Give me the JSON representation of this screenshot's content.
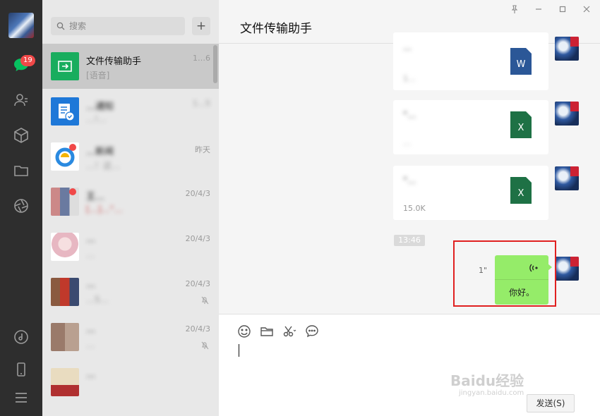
{
  "rail": {
    "unread_badge": "19"
  },
  "list": {
    "search_placeholder": "搜索",
    "add_label": "+",
    "sessions": [
      {
        "name": "文件传输助手",
        "time": "1…6",
        "msg": "[语音]",
        "active": true
      },
      {
        "name": "…通知",
        "time": "1…5",
        "msg": "…!…",
        "active": false
      },
      {
        "name": "…新闻",
        "time": "昨天",
        "msg": "…！这…",
        "active": false
      },
      {
        "name": "王…",
        "time": "20/4/3",
        "msg": "[…]…“…",
        "active": false
      },
      {
        "name": "…",
        "time": "20/4/3",
        "msg": "…",
        "active": false
      },
      {
        "name": "…",
        "time": "20/4/3",
        "msg": "…5…",
        "active": false
      },
      {
        "name": "…",
        "time": "20/4/3",
        "msg": "…",
        "active": false
      },
      {
        "name": "…",
        "time": "",
        "msg": "",
        "active": false
      }
    ]
  },
  "chat": {
    "title": "文件传输助手",
    "files": [
      {
        "name": "…",
        "size": "1…",
        "type": "W"
      },
      {
        "name": "“…",
        "size": "…",
        "type": "X"
      },
      {
        "name": "“…",
        "size": "15.0K",
        "type": "X"
      }
    ],
    "timestamp": "13:46",
    "voice": {
      "duration": "1\"",
      "text": "你好。"
    },
    "send_label": "发送(S)"
  },
  "watermark": {
    "text": "Baidu经验",
    "sub": "jingyan.baidu.com"
  },
  "colors": {
    "accent_green": "#95ec69",
    "badge_red": "#f04848",
    "rail_bg": "#2e2e2e"
  }
}
